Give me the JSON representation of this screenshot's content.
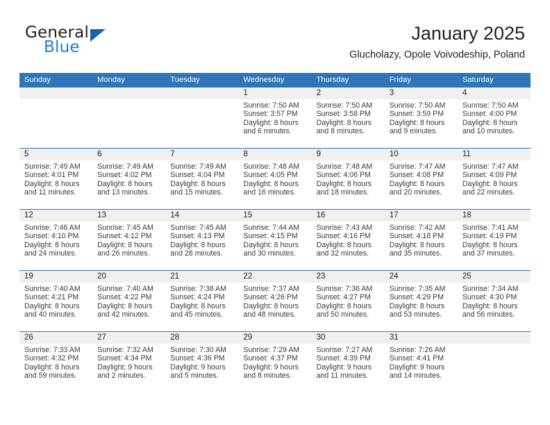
{
  "brand": {
    "name_top": "General",
    "name_bottom": "Blue",
    "accent_color": "#1c7fd4",
    "triangle_color": "#1464ad",
    "logo_icon": "triangle-icon"
  },
  "header": {
    "title": "January 2025",
    "subtitle": "Glucholazy, Opole Voivodeship, Poland"
  },
  "theme": {
    "header_blue": "#2e76b8",
    "daynum_band": "#f0f0f0",
    "text": "#231f20"
  },
  "calendar": {
    "weekdays": [
      "Sunday",
      "Monday",
      "Tuesday",
      "Wednesday",
      "Thursday",
      "Friday",
      "Saturday"
    ],
    "weeks": [
      [
        {
          "day": "",
          "lines": []
        },
        {
          "day": "",
          "lines": []
        },
        {
          "day": "",
          "lines": []
        },
        {
          "day": "1",
          "lines": [
            "Sunrise: 7:50 AM",
            "Sunset: 3:57 PM",
            "Daylight: 8 hours",
            "and 6 minutes."
          ]
        },
        {
          "day": "2",
          "lines": [
            "Sunrise: 7:50 AM",
            "Sunset: 3:58 PM",
            "Daylight: 8 hours",
            "and 8 minutes."
          ]
        },
        {
          "day": "3",
          "lines": [
            "Sunrise: 7:50 AM",
            "Sunset: 3:59 PM",
            "Daylight: 8 hours",
            "and 9 minutes."
          ]
        },
        {
          "day": "4",
          "lines": [
            "Sunrise: 7:50 AM",
            "Sunset: 4:00 PM",
            "Daylight: 8 hours",
            "and 10 minutes."
          ]
        }
      ],
      [
        {
          "day": "5",
          "lines": [
            "Sunrise: 7:49 AM",
            "Sunset: 4:01 PM",
            "Daylight: 8 hours",
            "and 11 minutes."
          ]
        },
        {
          "day": "6",
          "lines": [
            "Sunrise: 7:49 AM",
            "Sunset: 4:02 PM",
            "Daylight: 8 hours",
            "and 13 minutes."
          ]
        },
        {
          "day": "7",
          "lines": [
            "Sunrise: 7:49 AM",
            "Sunset: 4:04 PM",
            "Daylight: 8 hours",
            "and 15 minutes."
          ]
        },
        {
          "day": "8",
          "lines": [
            "Sunrise: 7:48 AM",
            "Sunset: 4:05 PM",
            "Daylight: 8 hours",
            "and 16 minutes."
          ]
        },
        {
          "day": "9",
          "lines": [
            "Sunrise: 7:48 AM",
            "Sunset: 4:06 PM",
            "Daylight: 8 hours",
            "and 18 minutes."
          ]
        },
        {
          "day": "10",
          "lines": [
            "Sunrise: 7:47 AM",
            "Sunset: 4:08 PM",
            "Daylight: 8 hours",
            "and 20 minutes."
          ]
        },
        {
          "day": "11",
          "lines": [
            "Sunrise: 7:47 AM",
            "Sunset: 4:09 PM",
            "Daylight: 8 hours",
            "and 22 minutes."
          ]
        }
      ],
      [
        {
          "day": "12",
          "lines": [
            "Sunrise: 7:46 AM",
            "Sunset: 4:10 PM",
            "Daylight: 8 hours",
            "and 24 minutes."
          ]
        },
        {
          "day": "13",
          "lines": [
            "Sunrise: 7:45 AM",
            "Sunset: 4:12 PM",
            "Daylight: 8 hours",
            "and 26 minutes."
          ]
        },
        {
          "day": "14",
          "lines": [
            "Sunrise: 7:45 AM",
            "Sunset: 4:13 PM",
            "Daylight: 8 hours",
            "and 28 minutes."
          ]
        },
        {
          "day": "15",
          "lines": [
            "Sunrise: 7:44 AM",
            "Sunset: 4:15 PM",
            "Daylight: 8 hours",
            "and 30 minutes."
          ]
        },
        {
          "day": "16",
          "lines": [
            "Sunrise: 7:43 AM",
            "Sunset: 4:16 PM",
            "Daylight: 8 hours",
            "and 32 minutes."
          ]
        },
        {
          "day": "17",
          "lines": [
            "Sunrise: 7:42 AM",
            "Sunset: 4:18 PM",
            "Daylight: 8 hours",
            "and 35 minutes."
          ]
        },
        {
          "day": "18",
          "lines": [
            "Sunrise: 7:41 AM",
            "Sunset: 4:19 PM",
            "Daylight: 8 hours",
            "and 37 minutes."
          ]
        }
      ],
      [
        {
          "day": "19",
          "lines": [
            "Sunrise: 7:40 AM",
            "Sunset: 4:21 PM",
            "Daylight: 8 hours",
            "and 40 minutes."
          ]
        },
        {
          "day": "20",
          "lines": [
            "Sunrise: 7:40 AM",
            "Sunset: 4:22 PM",
            "Daylight: 8 hours",
            "and 42 minutes."
          ]
        },
        {
          "day": "21",
          "lines": [
            "Sunrise: 7:38 AM",
            "Sunset: 4:24 PM",
            "Daylight: 8 hours",
            "and 45 minutes."
          ]
        },
        {
          "day": "22",
          "lines": [
            "Sunrise: 7:37 AM",
            "Sunset: 4:26 PM",
            "Daylight: 8 hours",
            "and 48 minutes."
          ]
        },
        {
          "day": "23",
          "lines": [
            "Sunrise: 7:36 AM",
            "Sunset: 4:27 PM",
            "Daylight: 8 hours",
            "and 50 minutes."
          ]
        },
        {
          "day": "24",
          "lines": [
            "Sunrise: 7:35 AM",
            "Sunset: 4:29 PM",
            "Daylight: 8 hours",
            "and 53 minutes."
          ]
        },
        {
          "day": "25",
          "lines": [
            "Sunrise: 7:34 AM",
            "Sunset: 4:30 PM",
            "Daylight: 8 hours",
            "and 56 minutes."
          ]
        }
      ],
      [
        {
          "day": "26",
          "lines": [
            "Sunrise: 7:33 AM",
            "Sunset: 4:32 PM",
            "Daylight: 8 hours",
            "and 59 minutes."
          ]
        },
        {
          "day": "27",
          "lines": [
            "Sunrise: 7:32 AM",
            "Sunset: 4:34 PM",
            "Daylight: 9 hours",
            "and 2 minutes."
          ]
        },
        {
          "day": "28",
          "lines": [
            "Sunrise: 7:30 AM",
            "Sunset: 4:36 PM",
            "Daylight: 9 hours",
            "and 5 minutes."
          ]
        },
        {
          "day": "29",
          "lines": [
            "Sunrise: 7:29 AM",
            "Sunset: 4:37 PM",
            "Daylight: 9 hours",
            "and 8 minutes."
          ]
        },
        {
          "day": "30",
          "lines": [
            "Sunrise: 7:27 AM",
            "Sunset: 4:39 PM",
            "Daylight: 9 hours",
            "and 11 minutes."
          ]
        },
        {
          "day": "31",
          "lines": [
            "Sunrise: 7:26 AM",
            "Sunset: 4:41 PM",
            "Daylight: 9 hours",
            "and 14 minutes."
          ]
        },
        {
          "day": "",
          "lines": []
        }
      ]
    ]
  }
}
